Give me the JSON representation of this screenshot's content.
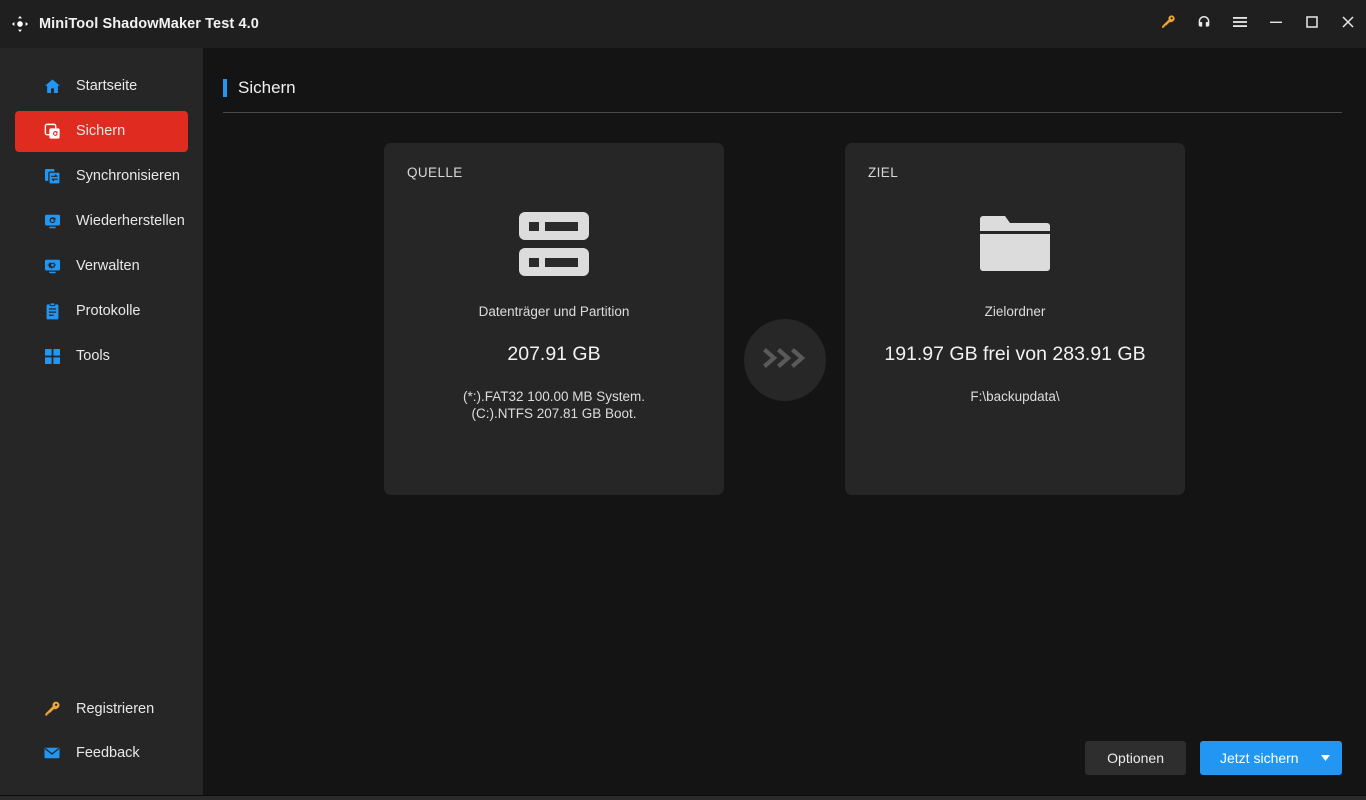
{
  "window": {
    "title": "MiniTool ShadowMaker Test 4.0",
    "logo_icon": "move-arrows-icon",
    "controls": [
      {
        "name": "license-key-button",
        "icon": "key-icon",
        "label": ""
      },
      {
        "name": "support-button",
        "icon": "headset-icon",
        "label": ""
      },
      {
        "name": "menu-button",
        "icon": "hamburger-menu-icon",
        "label": ""
      },
      {
        "name": "minimize-button",
        "icon": "minimize-icon",
        "label": ""
      },
      {
        "name": "maximize-button",
        "icon": "maximize-icon",
        "label": ""
      },
      {
        "name": "close-button",
        "icon": "close-icon",
        "label": ""
      }
    ]
  },
  "colors": {
    "accent_blue": "#2196f3",
    "active_red": "#e02b20",
    "key_yellow": "#f0a732",
    "sidebar_bg": "#262626",
    "content_bg": "#141414",
    "titlebar_bg": "#1f1f1f",
    "card_bg": "#262626"
  },
  "sidebar": {
    "items": [
      {
        "label": "Startseite",
        "icon": "home-icon",
        "active": false
      },
      {
        "label": "Sichern",
        "icon": "backup-icon",
        "active": true
      },
      {
        "label": "Synchronisieren",
        "icon": "sync-icon",
        "active": false
      },
      {
        "label": "Wiederherstellen",
        "icon": "restore-icon",
        "active": false
      },
      {
        "label": "Verwalten",
        "icon": "manage-icon",
        "active": false
      },
      {
        "label": "Protokolle",
        "icon": "logs-icon",
        "active": false
      },
      {
        "label": "Tools",
        "icon": "tools-icon",
        "active": false
      }
    ],
    "bottom_items": [
      {
        "label": "Registrieren",
        "icon": "key-icon"
      },
      {
        "label": "Feedback",
        "icon": "envelope-icon"
      }
    ]
  },
  "page": {
    "title": "Sichern"
  },
  "source_card": {
    "kicker": "QUELLE",
    "icon": "disk-stack-icon",
    "subtitle": "Datenträger und Partition",
    "size": "207.91 GB",
    "detail": "(*:).FAT32 100.00 MB System.\n(C:).NTFS 207.81 GB Boot."
  },
  "connector": {
    "icon": "triple-chevron-right-icon"
  },
  "destination_card": {
    "kicker": "ZIEL",
    "icon": "folder-icon",
    "subtitle": "Zielordner",
    "size": "191.97 GB frei von 283.91 GB",
    "detail": "F:\\backupdata\\"
  },
  "footer": {
    "options_label": "Optionen",
    "backup_now_label": "Jetzt sichern",
    "dropdown_icon": "caret-down-icon"
  }
}
